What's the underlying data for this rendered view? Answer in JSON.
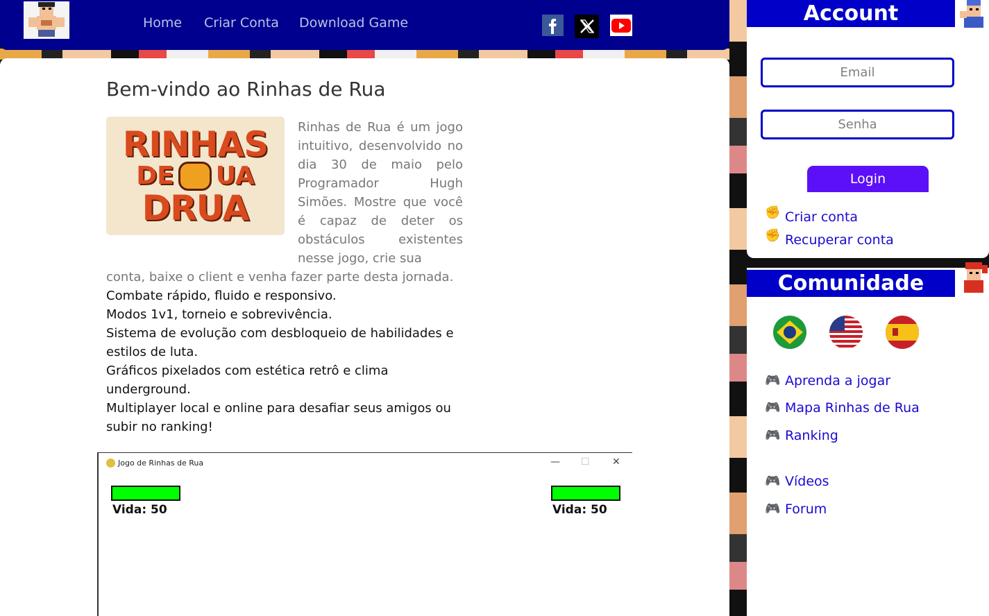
{
  "nav": {
    "home": "Home",
    "criar_conta": "Criar Conta",
    "download": "Download Game"
  },
  "social": [
    "facebook-icon",
    "x-icon",
    "youtube-icon"
  ],
  "main": {
    "title": "Bem-vindo ao Rinhas de Rua",
    "logo_lines": [
      "RINHAS",
      "DE",
      "UA",
      "DRUA"
    ],
    "intro": "Rinhas de Rua é um jogo intuitivo, desenvolvido no dia 30 de maio pelo Programador Hugh Simões. Mostre que você é capaz de deter os obstáculos existentes nesse jogo, crie sua",
    "intro_tail": "conta, baixe o client e venha fazer parte desta jornada.",
    "features": [
      "Combate rápido, fluido e responsivo.",
      "Modos 1v1, torneio e sobrevivência.",
      "Sistema de evolução com desbloqueio de habilidades e estilos de luta.",
      "Gráficos pixelados com estética retrô e clima underground.",
      "Multiplayer local e online para desafiar seus amigos ou subir no ranking!"
    ],
    "screenshot": {
      "window_title": "Jogo de Rinhas de Rua",
      "life_left": "Vida: 50",
      "life_right": "Vida: 50"
    }
  },
  "account": {
    "title": "Account",
    "email_placeholder": "Email",
    "senha_placeholder": "Senha",
    "login": "Login",
    "links": [
      "Criar conta",
      "Recuperar conta"
    ]
  },
  "comunidade": {
    "title": "Comunidade",
    "flags": [
      "brazil-flag",
      "usa-flag",
      "spain-flag"
    ],
    "links": [
      "Aprenda a jogar",
      "Mapa Rinhas de Rua",
      "Ranking",
      "Vídeos",
      "Forum"
    ]
  },
  "colors": {
    "nav_bg": "#00008f",
    "sidebar_head": "#0000c8",
    "login_btn": "#5b10f8",
    "link": "#1a0ad0",
    "hp_green": "#00ff00"
  }
}
